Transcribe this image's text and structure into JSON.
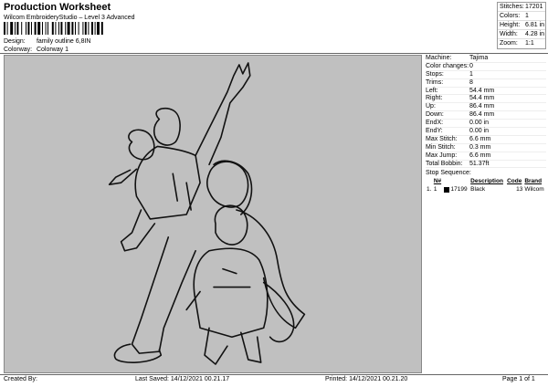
{
  "header": {
    "title": "Production Worksheet",
    "subtitle": "Wilcom EmbroideryStudio – Level 3 Advanced",
    "design_label": "Design:",
    "design_value": "family outline 6,8IN",
    "colorway_label": "Colorway:",
    "colorway_value": "Colorway 1"
  },
  "stats": [
    {
      "key": "Stitches:",
      "value": "17201"
    },
    {
      "key": "Colors:",
      "value": "1"
    },
    {
      "key": "Height:",
      "value": "6.81 in"
    },
    {
      "key": "Width:",
      "value": "4.28 in"
    },
    {
      "key": "Zoom:",
      "value": "1:1"
    }
  ],
  "params": [
    {
      "key": "Machine:",
      "value": "Tajima"
    },
    {
      "key": "Color changes:",
      "value": "0"
    },
    {
      "key": "Stops:",
      "value": "1"
    },
    {
      "key": "Trims:",
      "value": "8"
    },
    {
      "key": "Left:",
      "value": "54.4 mm"
    },
    {
      "key": "Right:",
      "value": "54.4 mm"
    },
    {
      "key": "Up:",
      "value": "86.4 mm"
    },
    {
      "key": "Down:",
      "value": "86.4 mm"
    },
    {
      "key": "EndX:",
      "value": "0.00 in"
    },
    {
      "key": "EndY:",
      "value": "0.00 in"
    },
    {
      "key": "Max Stitch:",
      "value": "6.6 mm"
    },
    {
      "key": "Min Stitch:",
      "value": "0.3 mm"
    },
    {
      "key": "Max Jump:",
      "value": "6.6 mm"
    },
    {
      "key": "Total Bobbin:",
      "value": "51.37ft"
    }
  ],
  "sequence": {
    "title": "Stop Sequence:",
    "headers": [
      "N#",
      "Description",
      "Code",
      "Brand"
    ],
    "rows": [
      {
        "stop": "1.",
        "n": "1",
        "stitches": "17199",
        "description": "Black",
        "code": "13",
        "brand": "Wilcom",
        "color": "#000000"
      }
    ]
  },
  "footer": {
    "created_by": "Created By:",
    "last_saved": "Last Saved: 14/12/2021 00.21.17",
    "printed": "Printed: 14/12/2021 00.21.20",
    "page": "Page 1 of 1"
  },
  "colors": {
    "design_bg": "#c0c0c0",
    "thread": "#000000"
  }
}
